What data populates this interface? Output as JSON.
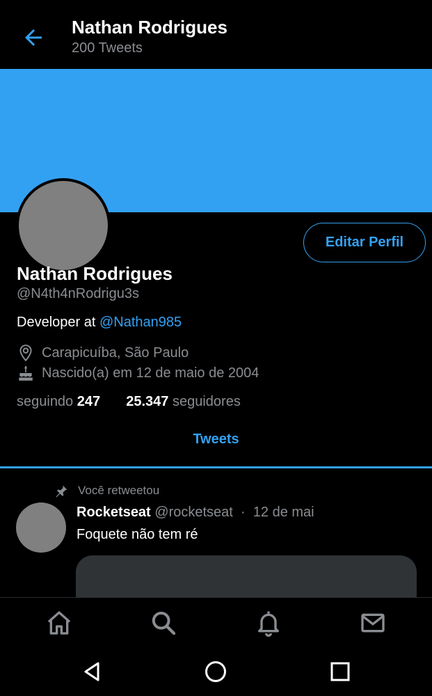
{
  "header": {
    "title": "Nathan Rodrigues",
    "subtitle": "200 Tweets",
    "back_icon": "arrow-left-icon"
  },
  "colors": {
    "accent": "#33a1f2",
    "banner": "#33a1f2",
    "avatar_placeholder": "#808080",
    "muted": "#8a8d91"
  },
  "profile": {
    "edit_button": "Editar Perfil",
    "name": "Nathan Rodrigues",
    "handle": "@N4th4nRodrigu3s",
    "bio_prefix": "Developer at ",
    "bio_mention": "@Nathan985",
    "location": "Carapicuíba, São Paulo",
    "birthday": "Nascido(a) em 12 de maio de 2004",
    "following_label": "seguindo",
    "following_count": "247",
    "followers_count": "25.347",
    "followers_label": "seguidores"
  },
  "tabs": {
    "active": "Tweets"
  },
  "tweet": {
    "retweet_label": "Você retweetou",
    "author": "Rocketseat",
    "author_handle": "@rocketseat",
    "separator": "·",
    "date": "12 de mai",
    "text": "Foquete não tem ré"
  },
  "bottom_nav": [
    "home-icon",
    "search-icon",
    "bell-icon",
    "mail-icon"
  ],
  "system_nav": [
    "back-triangle-icon",
    "home-circle-icon",
    "recents-square-icon"
  ]
}
